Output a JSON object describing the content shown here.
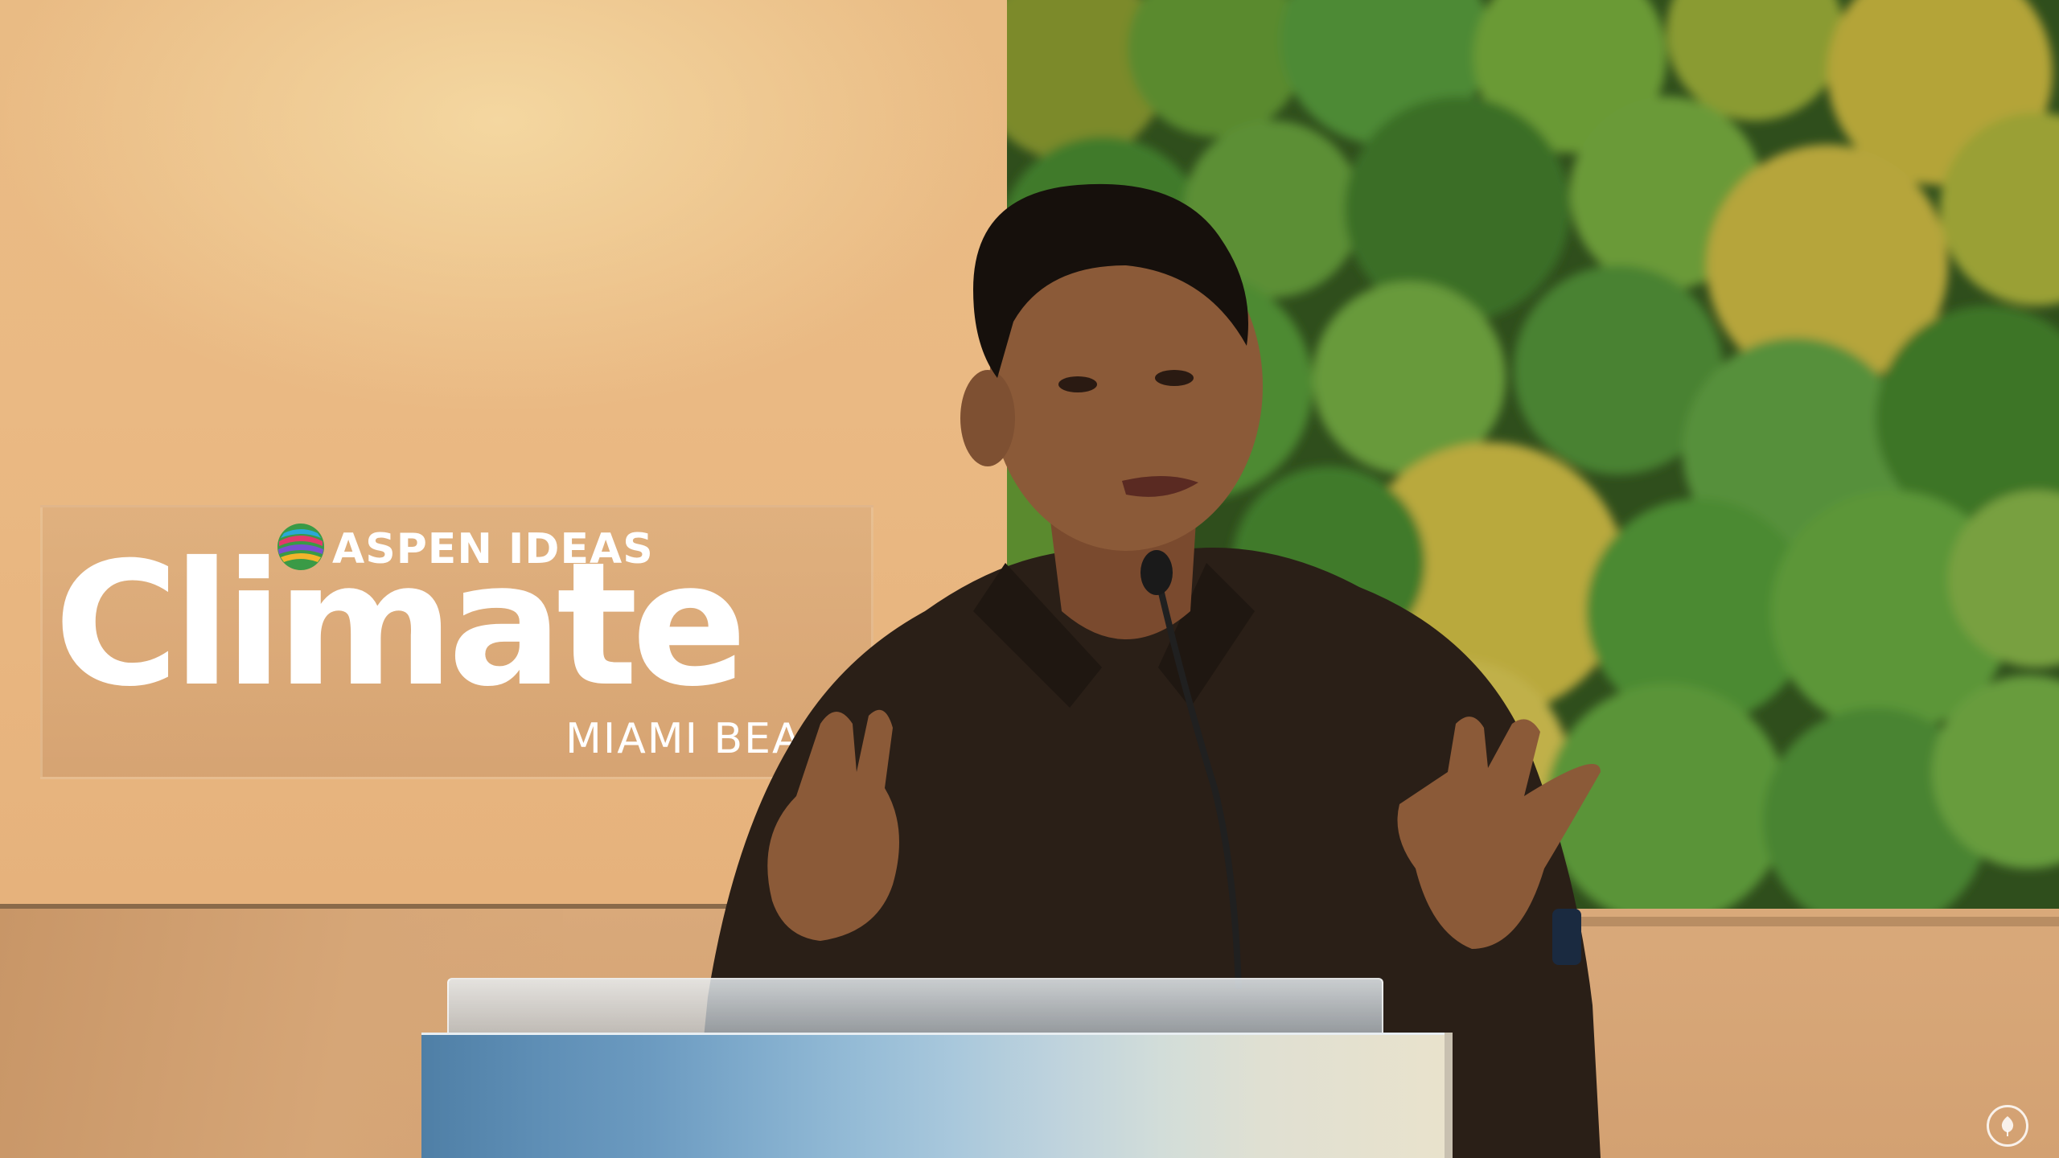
{
  "logo": {
    "brand": "ASPEN IDEAS",
    "title": "Climate",
    "location": "MIAMI BEACH",
    "globe_icon": "globe-icon"
  },
  "colors": {
    "backdrop": "#e9bb84",
    "moss": "#4f7a2a",
    "shirt": "#2a1f17",
    "podium_blue": "#5f8fb6"
  },
  "watermark": {
    "icon": "aspen-leaf-icon"
  }
}
